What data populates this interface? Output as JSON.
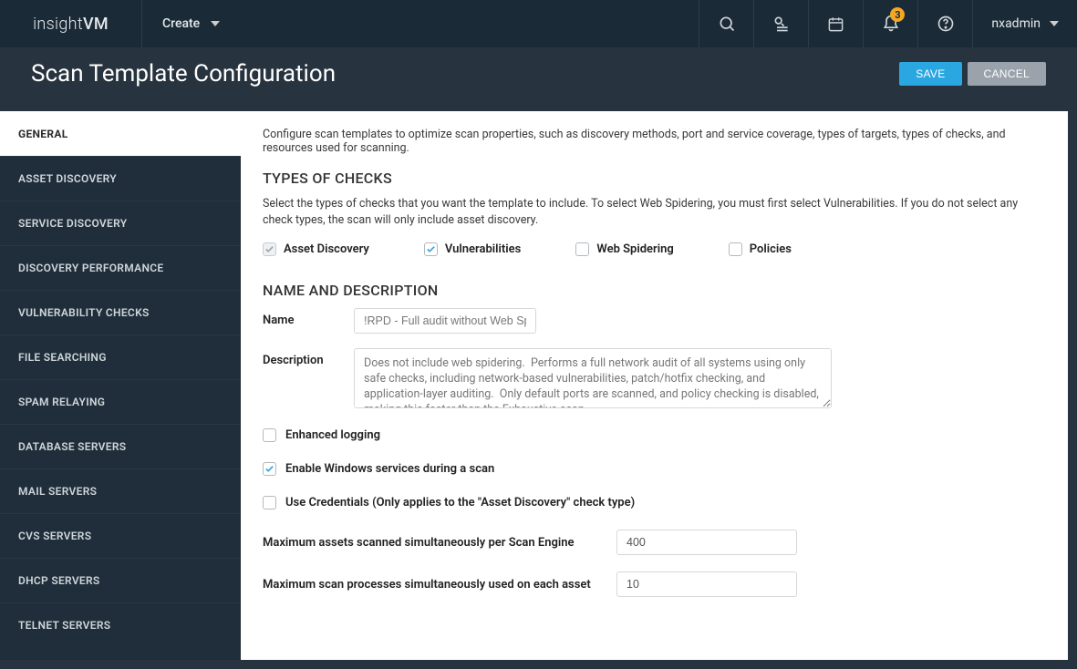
{
  "brand": {
    "thin": "insight",
    "bold": "VM"
  },
  "topbar": {
    "create": "Create",
    "notification_count": "3",
    "username": "nxadmin"
  },
  "header": {
    "title": "Scan Template Configuration",
    "save": "SAVE",
    "cancel": "CANCEL"
  },
  "sidebar": {
    "items": [
      "GENERAL",
      "ASSET DISCOVERY",
      "SERVICE DISCOVERY",
      "DISCOVERY PERFORMANCE",
      "VULNERABILITY CHECKS",
      "FILE SEARCHING",
      "SPAM RELAYING",
      "DATABASE SERVERS",
      "MAIL SERVERS",
      "CVS SERVERS",
      "DHCP SERVERS",
      "TELNET SERVERS"
    ],
    "active_index": 0
  },
  "main": {
    "intro": "Configure scan templates to optimize scan properties, such as discovery methods, port and service coverage, types of targets, types of checks, and resources used for scanning.",
    "types_heading": "TYPES OF CHECKS",
    "types_desc": "Select the types of checks that you want the template to include. To select Web Spidering, you must first select Vulnerabilities. If you do not select any check types, the scan will only include asset discovery.",
    "checks": {
      "asset_discovery": "Asset Discovery",
      "vulnerabilities": "Vulnerabilities",
      "web_spidering": "Web Spidering",
      "policies": "Policies"
    },
    "name_heading": "NAME AND DESCRIPTION",
    "name_label": "Name",
    "name_value": "!RPD - Full audit without Web Spider",
    "desc_label": "Description",
    "desc_value": "Does not include web spidering.  Performs a full network audit of all systems using only safe checks, including network-based vulnerabilities, patch/hotfix checking, and application-layer auditing.  Only default ports are scanned, and policy checking is disabled, making this faster than the Exhaustive scan.",
    "enhanced_logging": "Enhanced logging",
    "enable_windows": "Enable Windows services during a scan",
    "use_credentials": "Use Credentials (Only applies to the \"Asset Discovery\" check type)",
    "max_assets_label": "Maximum assets scanned simultaneously per Scan Engine",
    "max_assets_value": "400",
    "max_procs_label": "Maximum scan processes simultaneously used on each asset",
    "max_procs_value": "10"
  }
}
